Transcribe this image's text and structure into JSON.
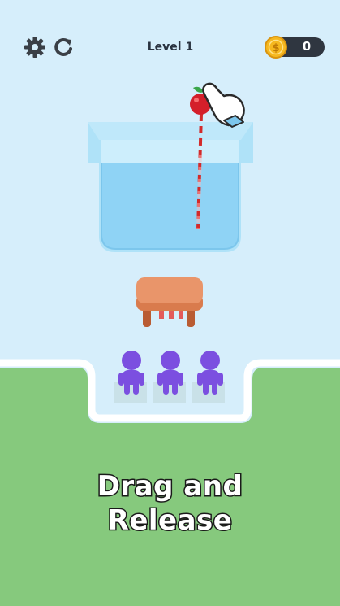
{
  "hud": {
    "level_label": "Level 1",
    "coins": "0",
    "settings_icon": "gear-icon",
    "restart_icon": "restart-icon",
    "coin_icon": "dollar-coin-icon"
  },
  "instruction": {
    "line1": "Drag and",
    "line2": "Release"
  },
  "colors": {
    "sky": "#d6eefb",
    "grass": "#86c97d",
    "water": "#8fd3f5",
    "character": "#7b4fe0",
    "table": "#e9956a",
    "coin": "#f6b81f",
    "trajectory": "#d32a2a"
  }
}
